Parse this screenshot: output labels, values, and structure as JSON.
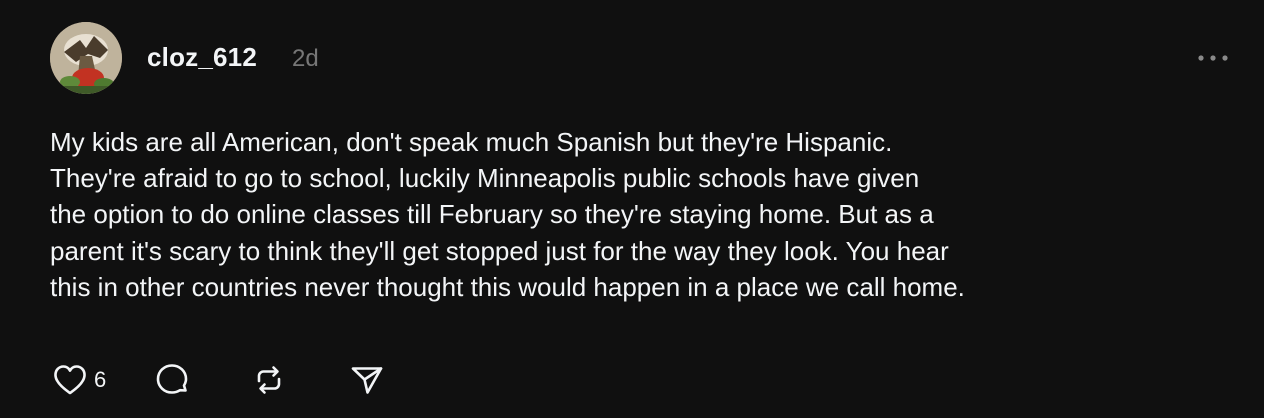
{
  "post": {
    "author": {
      "username": "cloz_612",
      "avatar_icon": "avatar-image"
    },
    "timestamp": "2d",
    "more_icon": "more-horizontal-icon",
    "text": "My kids are all American, don't speak much Spanish but they're Hispanic.\nThey're afraid to go to school, luckily Minneapolis public schools have given\nthe option to do online classes till February so they're staying home. But as a\nparent it's scary to think they'll get stopped just for the way they look. You hear\nthis in other countries never thought this would happen in a place we call home.",
    "actions": {
      "like": {
        "icon": "heart-icon",
        "count": "6"
      },
      "reply": {
        "icon": "comment-icon"
      },
      "repost": {
        "icon": "repost-icon"
      },
      "share": {
        "icon": "send-icon"
      }
    }
  },
  "colors": {
    "background": "#101010",
    "text_primary": "#f3f5f7",
    "text_secondary": "#777777"
  }
}
